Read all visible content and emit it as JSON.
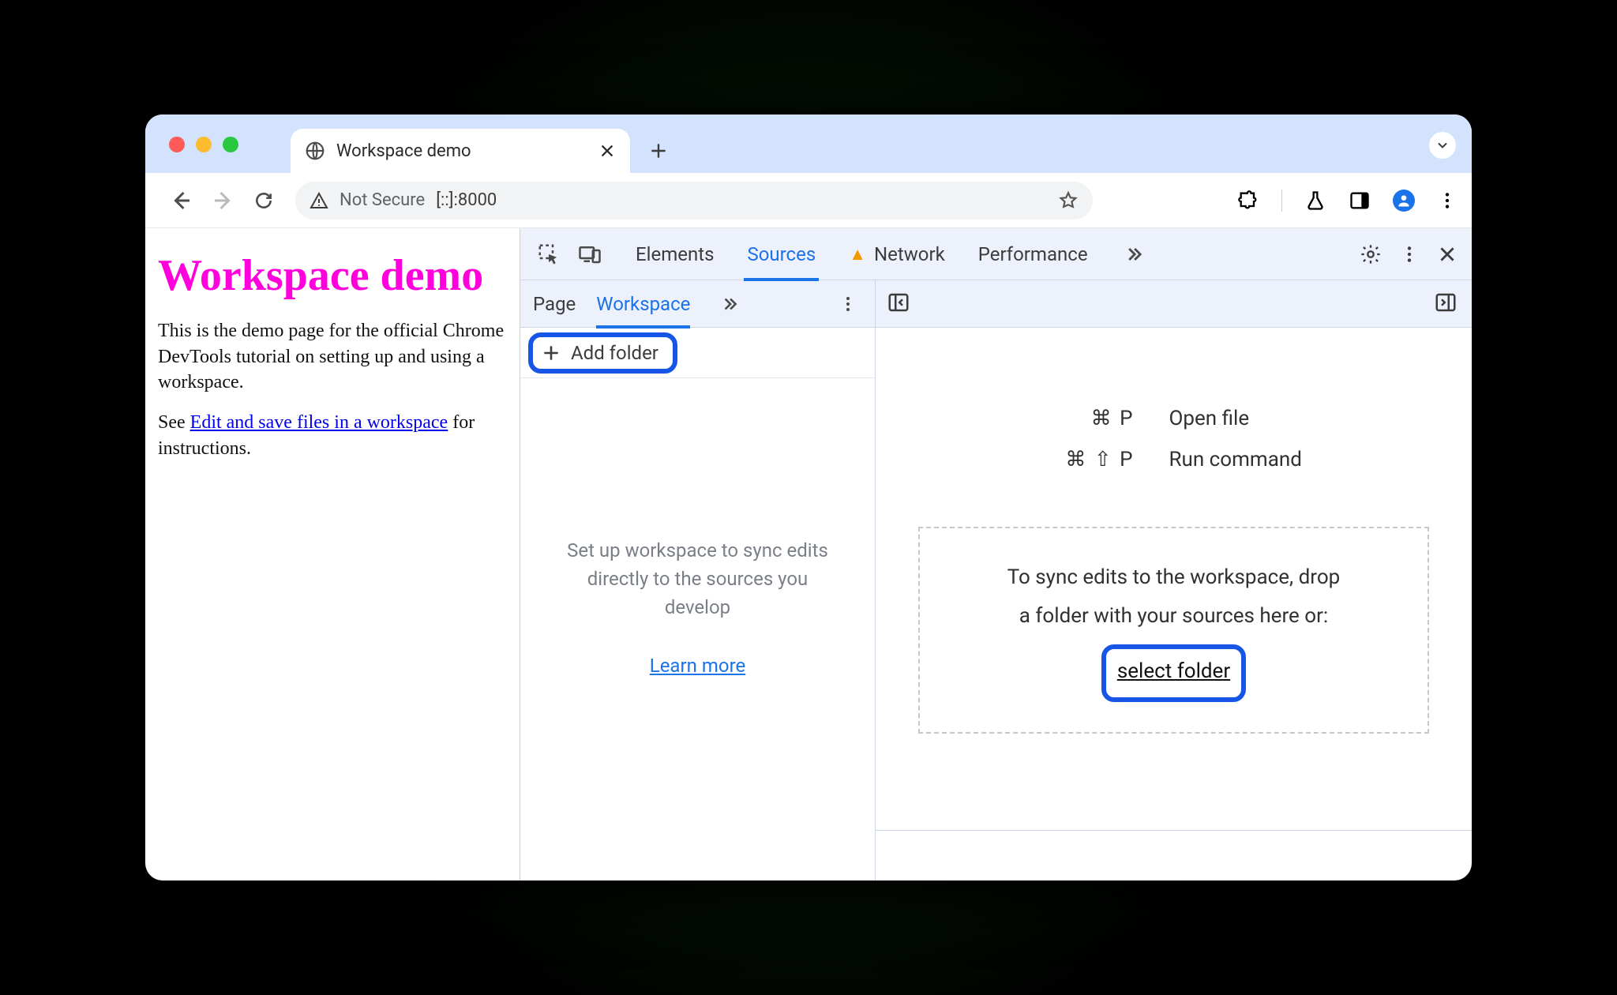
{
  "browser": {
    "tab_title": "Workspace demo",
    "address": {
      "not_secure_label": "Not Secure",
      "url": "[::]:8000"
    }
  },
  "page": {
    "heading": "Workspace demo",
    "paragraph1": "This is the demo page for the official Chrome DevTools tutorial on setting up and using a workspace.",
    "p2_prefix": "See ",
    "p2_link": "Edit and save files in a workspace",
    "p2_suffix": " for instructions."
  },
  "devtools": {
    "top_tabs": {
      "elements": "Elements",
      "sources": "Sources",
      "network": "Network",
      "performance": "Performance"
    },
    "sources_subtabs": {
      "page": "Page",
      "workspace": "Workspace"
    },
    "add_folder_label": "Add folder",
    "workspace_message": "Set up workspace to sync edits directly to the sources you develop",
    "learn_more_label": "Learn more",
    "shortcuts": {
      "open_file": {
        "keys": "⌘ P",
        "label": "Open file"
      },
      "run_command": {
        "keys": "⌘ ⇧ P",
        "label": "Run command"
      }
    },
    "drop_zone": {
      "text_line1": "To sync edits to the workspace, drop",
      "text_line2": "a folder with your sources here or:",
      "select_folder_label": "select folder"
    }
  }
}
